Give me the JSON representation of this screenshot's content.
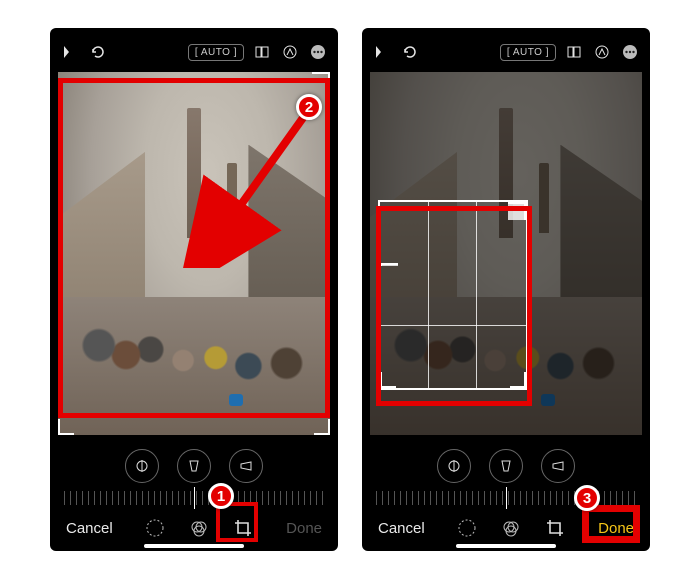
{
  "tutorial": {
    "step1": {
      "number": "1"
    },
    "step2": {
      "number": "2"
    },
    "step3": {
      "number": "3"
    }
  },
  "phone_left": {
    "topbar": {
      "auto_label": "[ AUTO ]"
    },
    "bottombar": {
      "cancel_label": "Cancel",
      "done_label": "Done"
    }
  },
  "phone_right": {
    "topbar": {
      "auto_label": "[ AUTO ]"
    },
    "bottombar": {
      "cancel_label": "Cancel",
      "done_label": "Done"
    }
  }
}
